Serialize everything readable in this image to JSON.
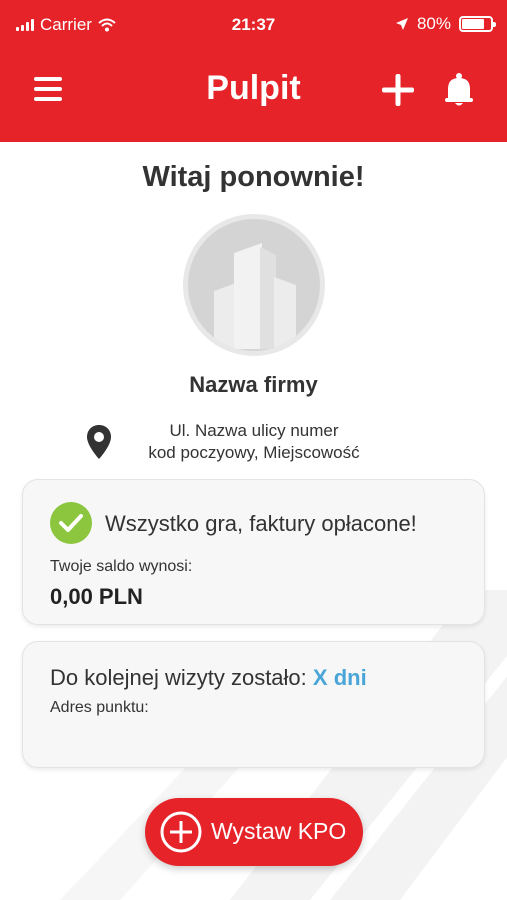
{
  "status_bar": {
    "carrier": "Carrier",
    "time": "21:37",
    "battery": "80%",
    "battery_level": 0.8
  },
  "nav": {
    "title": "Pulpit"
  },
  "greeting": "Witaj ponownie!",
  "company": {
    "name": "Nazwa firmy",
    "address_line1": "Ul. Nazwa ulicy numer",
    "address_line2": "kod poczyowy, Miejscowość"
  },
  "status_card": {
    "message": "Wszystko gra, faktury opłacone!",
    "balance_label": "Twoje saldo wynosi:",
    "balance_value": "0,00 PLN"
  },
  "visit_card": {
    "message": "Do kolejnej wizyty zostało:",
    "days": "X dni",
    "point_label": "Adres punktu:"
  },
  "action_button": {
    "label": "Wystaw KPO"
  },
  "colors": {
    "brand_red": "#e52329",
    "success_green": "#8cc63f",
    "accent_blue": "#4aa5d8"
  },
  "icons": [
    "menu-icon",
    "plus-icon",
    "bell-icon",
    "building-icon",
    "location-pin-icon",
    "check-icon",
    "plus-circle-icon",
    "wifi-icon",
    "location-arrow-icon",
    "battery-icon"
  ]
}
